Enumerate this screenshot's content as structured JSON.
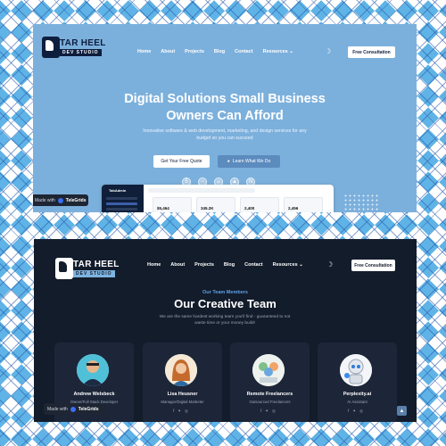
{
  "brand": {
    "name": "TAR HEEL",
    "tagline": "DEV STUDIO"
  },
  "nav": {
    "items": [
      "Home",
      "About",
      "Projects",
      "Blog",
      "Contact",
      "Resources"
    ],
    "dropdown_icon": "chevron-down-icon",
    "theme_icon": "moon-icon",
    "cta": "Free Consultation"
  },
  "hero": {
    "title_line1": "Digital Solutions Small Business",
    "title_line2": "Owners Can Afford",
    "subtitle": "Innovative software & web development, marketing, and design services for any budget so you can succeed",
    "primary_btn": "Get Your Free Quote",
    "secondary_btn": "Learn What We Do",
    "tech_icons": [
      "html-icon",
      "tailwind-icon",
      "react-icon",
      "angular-icon",
      "nextjs-icon"
    ]
  },
  "dashboard": {
    "app_name": "TabAdmin",
    "stats": [
      "$5,464",
      "345.2K",
      "2,400",
      "2,456"
    ]
  },
  "made_with": {
    "prefix": "Made with",
    "brand": "TeleGrids"
  },
  "team": {
    "label": "Our Team Members",
    "title": "Our Creative Team",
    "subtitle": "We are the same hardest working team you'll find - guaranteed to not waste time or your money build!",
    "members": [
      {
        "name": "Andrew Welsbeck",
        "role": "Owner/Full Stack Developer"
      },
      {
        "name": "Lisa Heusner",
        "role": "Manager/Digital Marketer"
      },
      {
        "name": "Remote Freelancers",
        "role": "Outsourced Freelancers"
      },
      {
        "name": "Perplexity.ai",
        "role": "AI Assistant"
      }
    ],
    "social_icons": [
      "facebook-icon",
      "twitter-icon",
      "instagram-icon"
    ]
  },
  "colors": {
    "hero_bg": "#7cb0dc",
    "dark_bg": "#131c2b",
    "accent": "#5aa0e6"
  }
}
